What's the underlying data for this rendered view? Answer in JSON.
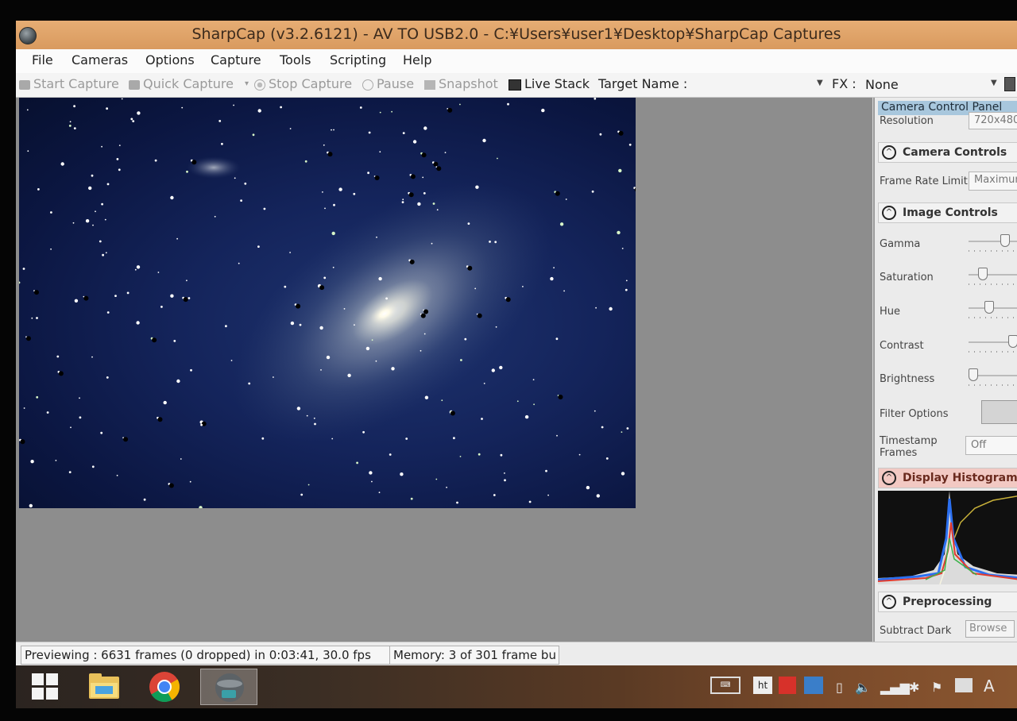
{
  "window": {
    "title": "SharpCap (v3.2.6121) - AV TO USB2.0 - C:¥Users¥user1¥Desktop¥SharpCap Captures"
  },
  "menu": [
    "File",
    "Cameras",
    "Options",
    "Capture",
    "Tools",
    "Scripting",
    "Help"
  ],
  "toolbar": {
    "start_capture": "Start Capture",
    "quick_capture": "Quick Capture",
    "stop_capture": "Stop Capture",
    "pause": "Pause",
    "snapshot": "Snapshot",
    "live_stack": "Live Stack",
    "target_name_label": "Target Name :",
    "fx_label": "FX :",
    "fx_value": "None"
  },
  "panel": {
    "header": "Camera Control Panel",
    "resolution_label": "Resolution",
    "resolution_value": "720x480",
    "camera_controls_title": "Camera Controls",
    "frame_rate_label": "Frame Rate Limit",
    "frame_rate_value": "Maximum",
    "image_controls_title": "Image Controls",
    "gamma_label": "Gamma",
    "saturation_label": "Saturation",
    "hue_label": "Hue",
    "contrast_label": "Contrast",
    "brightness_label": "Brightness",
    "filter_options_label": "Filter Options",
    "timestamp_label_1": "Timestamp",
    "timestamp_label_2": "Frames",
    "timestamp_value": "Off",
    "histogram_title": "Display Histogram St",
    "preprocessing_title": "Preprocessing",
    "subtract_dark_label": "Subtract Dark",
    "browse_label": "Browse"
  },
  "status": {
    "previewing": "Previewing : 6631 frames (0 dropped) in 0:03:41, 30.0 fps",
    "memory": "Memory: 3 of 301 frame bu"
  },
  "taskbar": {
    "apps": [
      "windows-start",
      "file-explorer",
      "chrome",
      "sharpcap"
    ],
    "tray_text": "A"
  },
  "colors": {
    "titlebar": "#e0a46b",
    "panel_header": "#a8c7dd",
    "histogram_header": "#f2c9c3",
    "sky": "#14245b"
  }
}
